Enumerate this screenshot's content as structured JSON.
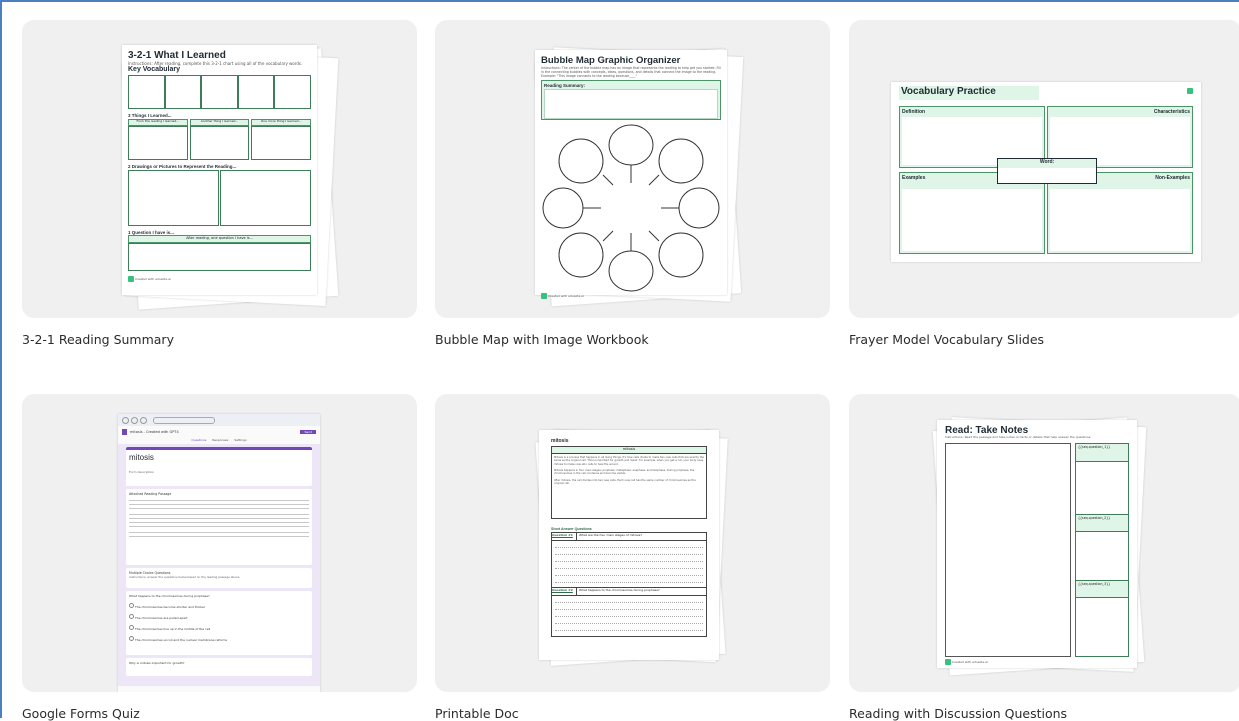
{
  "templates": [
    {
      "caption": "3-2-1 Reading Summary",
      "preview": {
        "title": "3-2-1 What I Learned",
        "instructions": "Instructions: After reading, complete this 3-2-1 chart using all of the vocabulary words.",
        "vocab_heading": "Key Vocabulary",
        "things_heading": "3 Things I Learned...",
        "things_cols": [
          "From the reading I learned...",
          "Another thing I learned...",
          "One more thing I learned..."
        ],
        "drawings_heading": "2 Drawings or Pictures to Represent the Reading...",
        "question_heading": "1 Question I have is...",
        "question_prompt": "After reading, one question I have is...",
        "footer": "Created with eduaide.ai"
      }
    },
    {
      "caption": "Bubble Map with Image Workbook",
      "preview": {
        "title": "Bubble Map Graphic Organizer",
        "instructions": "Instructions: The center of the bubble map has an image that represents the reading to help get you started. Fill in the connecting bubbles with concepts, ideas, questions, and details that connect the image to the reading. Example: \"This image connects to the reading because____\"",
        "summary_label": "Reading Summary:",
        "footer": "Created with eduaide.ai"
      }
    },
    {
      "caption": "Frayer Model Vocabulary Slides",
      "preview": {
        "title": "Vocabulary Practice",
        "definition": "Definition",
        "characteristics": "Characteristics",
        "word": "Word:",
        "examples": "Examples",
        "non_examples": "Non-Examples"
      }
    },
    {
      "caption": "Google Forms Quiz",
      "preview": {
        "doc_title": "mitosis - Created with GPT4",
        "tabs": [
          "Questions",
          "Responses",
          "Settings"
        ],
        "send": "Send",
        "form_title": "mitosis",
        "description": "Form description",
        "passage_heading": "Attached Reading Passage",
        "mc_heading": "Multiple Choice Questions",
        "mc_instructions": "Instructions: Answer the questions below based on the reading passage above.",
        "q1": "What happens to the chromosomes during prophase?",
        "options": [
          "The chromosomes become shorter and thicker",
          "The chromosomes are pulled apart",
          "The chromosomes line up in the middle of the cell",
          "The chromosomes uncoil and the nuclear membrane reforms"
        ],
        "q2": "Why is mitosis important for growth?"
      }
    },
    {
      "caption": "Printable Doc",
      "preview": {
        "title": "mitosis",
        "table_header": "mitosis",
        "para1": "Mitosis is a process that happens in all living things. It's how cells divide to make two new cells that are exactly the same as the original cell. This is important for growth and repair. For example, when you get a cut, your body uses mitosis to make new skin cells to heal the wound.",
        "para2": "Mitosis happens in four main stages: prophase, metaphase, anaphase, and telophase. During prophase, the chromosomes in the cell condense and become visible.",
        "para3": "After mitosis, the cell divides into two new cells. Each new cell has the same number of chromosomes as the original cell.",
        "sa_heading": "Short Answer Questions",
        "q1_label": "Question #1",
        "q1": "What are the four main stages of mitosis?",
        "q2_label": "Question #2",
        "q2": "What happens to the chromosomes during prophase?"
      }
    },
    {
      "caption": "Reading with Discussion Questions",
      "preview": {
        "title": "Read: Take Notes",
        "instructions": "Instructions: Read the passage and take notes on facts or details that help answer the questions.",
        "questions": [
          "{{seq.question_1}}",
          "{{seq.question_2}}",
          "{{seq.question_3}}"
        ],
        "footer": "Created with eduaide.ai"
      }
    }
  ]
}
